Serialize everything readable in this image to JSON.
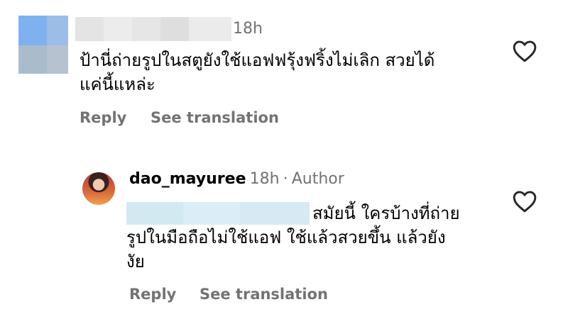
{
  "comment1": {
    "time": "18h",
    "text_line1": "ป้านี่ถ่ายรูปในสตูยังใช้แอฟฟรุ้งฟริ้งไม่เลิก สวยได้",
    "text_line2": "แค่นี้แหล่ะ",
    "reply_label": "Reply",
    "translate_label": "See translation"
  },
  "comment2": {
    "username": "dao_mayuree",
    "time": "18h",
    "separator": "·",
    "author_tag": "Author",
    "text_line1": "สมัยนี้ ใครบ้างที่ถ่าย",
    "text_line2": "รูปในมือถือไม่ใช้แอฟ ใช้แล้วสวยขึ้น แล้วยัง",
    "text_line3": "งัย",
    "reply_label": "Reply",
    "translate_label": "See translation"
  },
  "icons": {
    "like": "heart-outline-icon"
  },
  "colors": {
    "secondary_text": "#737373",
    "mention_blur": "#d7ebf3"
  }
}
